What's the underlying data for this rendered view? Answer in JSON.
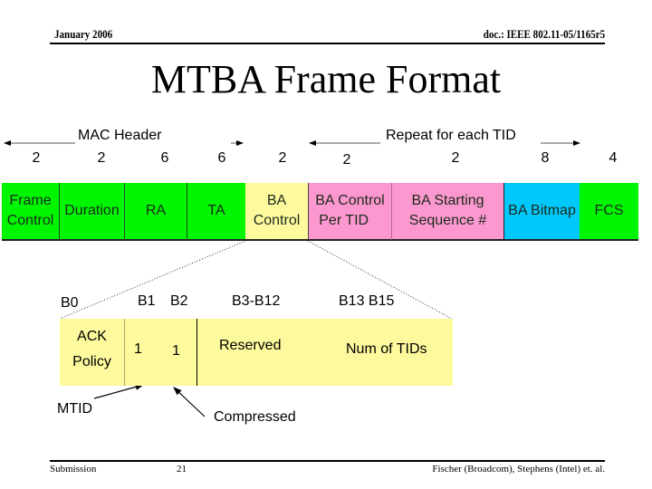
{
  "header": {
    "date": "January 2006",
    "doc_id": "doc.: IEEE 802.11-05/1165r5"
  },
  "title": "MTBA Frame Format",
  "frame": {
    "span_labels": {
      "mac_header": "MAC Header",
      "repeat": "Repeat for each TID"
    },
    "fields": [
      {
        "label_line1": "Frame",
        "label_line2": "Control",
        "size": "2",
        "color": "green"
      },
      {
        "label_line1": "Duration",
        "label_line2": "",
        "size": "2",
        "color": "green"
      },
      {
        "label_line1": "RA",
        "label_line2": "",
        "size": "6",
        "color": "green"
      },
      {
        "label_line1": "TA",
        "label_line2": "",
        "size": "6",
        "color": "green"
      },
      {
        "label_line1": "BA",
        "label_line2": "Control",
        "size": "2",
        "color": "yellow"
      },
      {
        "label_line1": "BA Control",
        "label_line2": "Per TID",
        "size": "2",
        "color": "pink"
      },
      {
        "label_line1": "BA Starting",
        "label_line2": "Sequence #",
        "size": "2",
        "color": "pink"
      },
      {
        "label_line1": "BA Bitmap",
        "label_line2": "",
        "size": "8",
        "color": "blue"
      },
      {
        "label_line1": "FCS",
        "label_line2": "",
        "size": "4",
        "color": "green"
      }
    ],
    "colors": {
      "green": "#00f600",
      "yellow": "#fdfa9e",
      "pink": "#fc98cf",
      "blue": "#00c8fa"
    }
  },
  "ba_control": {
    "bit_labels": [
      "B0",
      "B1",
      "B2",
      "B3-B12",
      "B13 B15"
    ],
    "subfields": {
      "ack_policy_line1": "ACK",
      "ack_policy_line2": "Policy",
      "mtid_value": "1",
      "compressed_value": "1",
      "reserved": "Reserved",
      "num_tids": "Num of TIDs"
    },
    "annotations": {
      "mtid": "MTID",
      "compressed": "Compressed"
    }
  },
  "footer": {
    "left": "Submission",
    "page": "21",
    "right": "Fischer (Broadcom), Stephens (Intel) et. al."
  }
}
